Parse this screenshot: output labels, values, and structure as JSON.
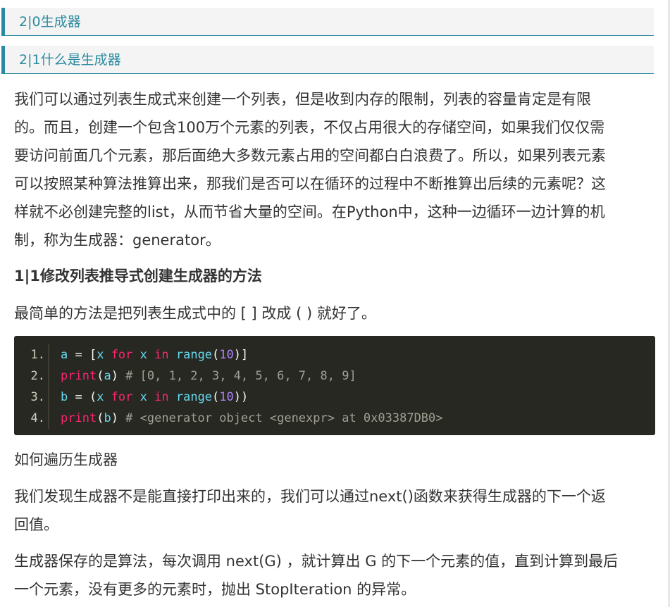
{
  "headings": {
    "h20": "2|0生成器",
    "h21": "2|1什么是生成器"
  },
  "paragraphs": {
    "intro": [
      "我们可以通过列表生成式来创建一个列表，但是收到内存的限制，列表的容量肯定是有限",
      "的。而且，创建一个包含100万个元素的列表，不仅占用很大的存储空间，如果我们仅仅需",
      "要访问前面几个元素，那后面绝大多数元素占用的空间都白白浪费了。所以，如果列表元素",
      "可以按照某种算法推算出来，那我们是否可以在循环的过程中不断推算出后续的元素呢？这",
      "样就不必创建完整的list，从而节省大量的空间。在Python中，这种一边循环一边计算的机",
      "制，称为生成器：generator。"
    ],
    "sub_heading": "1|1修改列表推导式创建生成器的方法",
    "simple": "最简单的方法是把列表生成式中的 [ ] 改成 ( ) 就好了。",
    "iterate": "如何遍历生成器",
    "next_desc": [
      "我们发现生成器不是能直接打印出来的，我们可以通过next()函数来获得生成器的下一个返",
      "回值。"
    ],
    "algo": [
      "生成器保存的是算法，每次调用 next(G) ，就计算出 G 的下一个元素的值，直到计算到最后",
      "一个元素，没有更多的元素时，抛出 StopIteration 的异常。"
    ]
  },
  "code": {
    "line_numbers": [
      "1.",
      "2.",
      "3.",
      "4."
    ],
    "lines": [
      [
        {
          "t": "a",
          "c": "var"
        },
        {
          "t": " = [",
          "c": "p"
        },
        {
          "t": "x ",
          "c": "var"
        },
        {
          "t": "for",
          "c": "kw"
        },
        {
          "t": " x ",
          "c": "var"
        },
        {
          "t": "in",
          "c": "kw"
        },
        {
          "t": " ",
          "c": "p"
        },
        {
          "t": "range",
          "c": "fn"
        },
        {
          "t": "(",
          "c": "p"
        },
        {
          "t": "10",
          "c": "num"
        },
        {
          "t": ")]",
          "c": "p"
        }
      ],
      [
        {
          "t": "print",
          "c": "kw"
        },
        {
          "t": "(",
          "c": "p"
        },
        {
          "t": "a",
          "c": "var"
        },
        {
          "t": ") ",
          "c": "p"
        },
        {
          "t": "# [0, 1, 2, 3, 4, 5, 6, 7, 8, 9]",
          "c": "cm"
        }
      ],
      [
        {
          "t": "b",
          "c": "var"
        },
        {
          "t": " = (",
          "c": "p"
        },
        {
          "t": "x ",
          "c": "var"
        },
        {
          "t": "for",
          "c": "kw"
        },
        {
          "t": " x ",
          "c": "var"
        },
        {
          "t": "in",
          "c": "kw"
        },
        {
          "t": " ",
          "c": "p"
        },
        {
          "t": "range",
          "c": "fn"
        },
        {
          "t": "(",
          "c": "p"
        },
        {
          "t": "10",
          "c": "num"
        },
        {
          "t": "))",
          "c": "p"
        }
      ],
      [
        {
          "t": "print",
          "c": "kw"
        },
        {
          "t": "(",
          "c": "p"
        },
        {
          "t": "b",
          "c": "var"
        },
        {
          "t": ") ",
          "c": "p"
        },
        {
          "t": "# <generator object <genexpr> at 0x03387DB0>",
          "c": "cm"
        }
      ]
    ]
  },
  "colors": {
    "accent": "#2b8a9f",
    "code_bg": "#272822"
  }
}
